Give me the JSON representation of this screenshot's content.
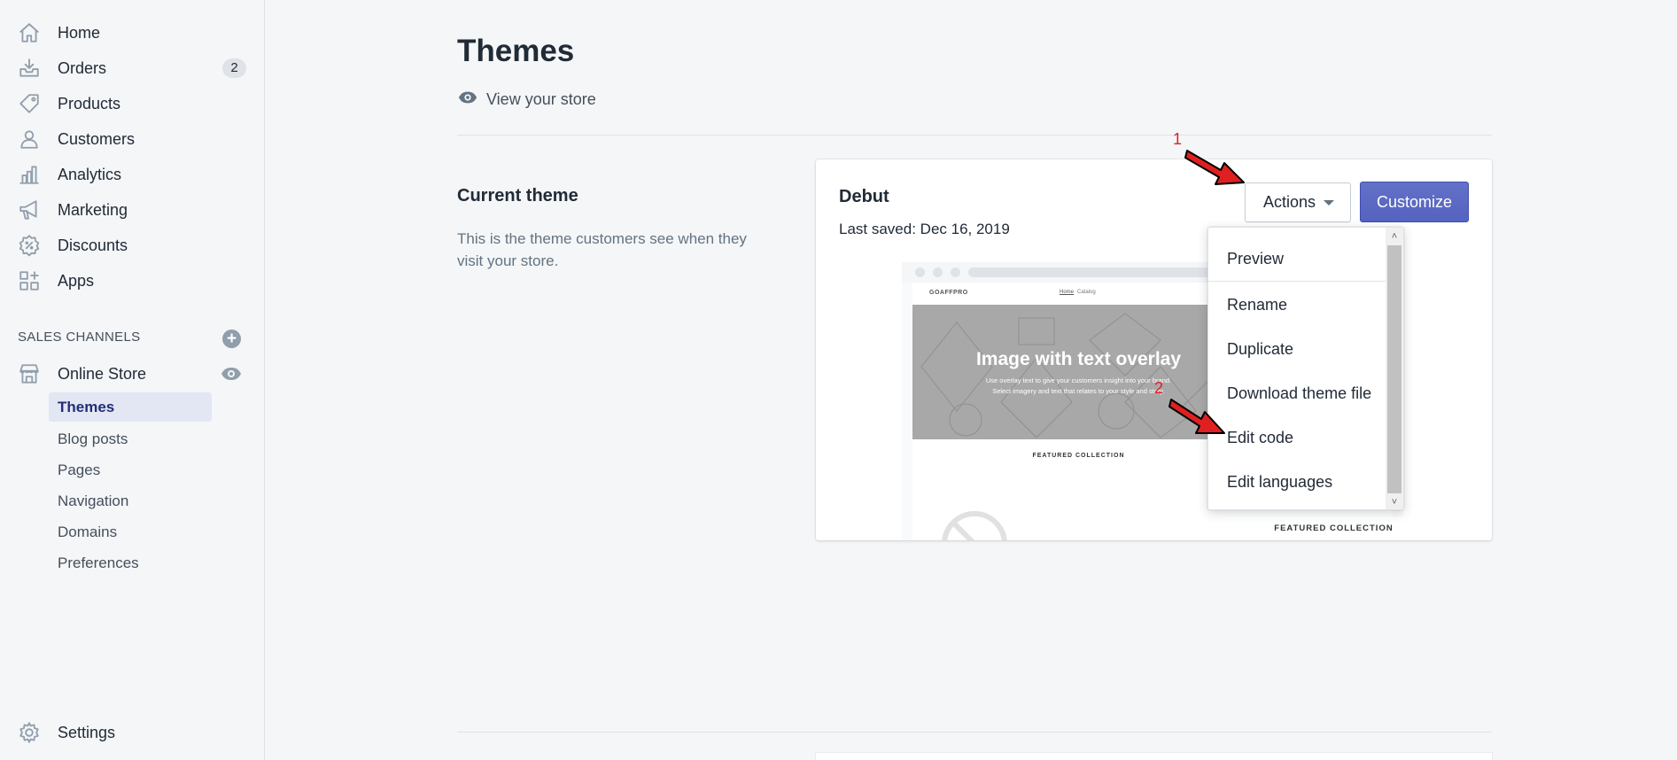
{
  "sidebar": {
    "items": [
      {
        "label": "Home",
        "icon": "home-icon"
      },
      {
        "label": "Orders",
        "icon": "orders-icon",
        "badge": "2"
      },
      {
        "label": "Products",
        "icon": "tag-icon"
      },
      {
        "label": "Customers",
        "icon": "person-icon"
      },
      {
        "label": "Analytics",
        "icon": "bar-chart-icon"
      },
      {
        "label": "Marketing",
        "icon": "megaphone-icon"
      },
      {
        "label": "Discounts",
        "icon": "discount-icon"
      },
      {
        "label": "Apps",
        "icon": "apps-icon"
      }
    ],
    "sales_channels_heading": "SALES CHANNELS",
    "online_store_label": "Online Store",
    "sub_items": [
      "Themes",
      "Blog posts",
      "Pages",
      "Navigation",
      "Domains",
      "Preferences"
    ],
    "settings_label": "Settings"
  },
  "main": {
    "title": "Themes",
    "view_store": "View your store",
    "current_theme_title": "Current theme",
    "current_theme_desc": "This is the theme customers see when they visit your store.",
    "theme_name": "Debut",
    "last_saved": "Last saved: Dec 16, 2019",
    "actions_label": "Actions",
    "customize_label": "Customize"
  },
  "preview": {
    "logo": "GOAFFPRO",
    "nav_home": "Home",
    "nav_catalog": "Catalog",
    "hero_title": "Image with text overlay",
    "hero_sub1": "Use overlay text to give your customers insight into your brand.",
    "hero_sub2": "Select imagery and text that relates to your style and story.",
    "featured": "FEATURED COLLECTION"
  },
  "dropdown": {
    "items": [
      "Preview",
      "Rename",
      "Duplicate",
      "Download theme file",
      "Edit code",
      "Edit languages"
    ]
  },
  "annotations": {
    "marker1": "1",
    "marker2": "2"
  },
  "colors": {
    "accent": "#5c6ac4",
    "active_bg": "#e3e6f3",
    "arrow": "#e02020"
  }
}
